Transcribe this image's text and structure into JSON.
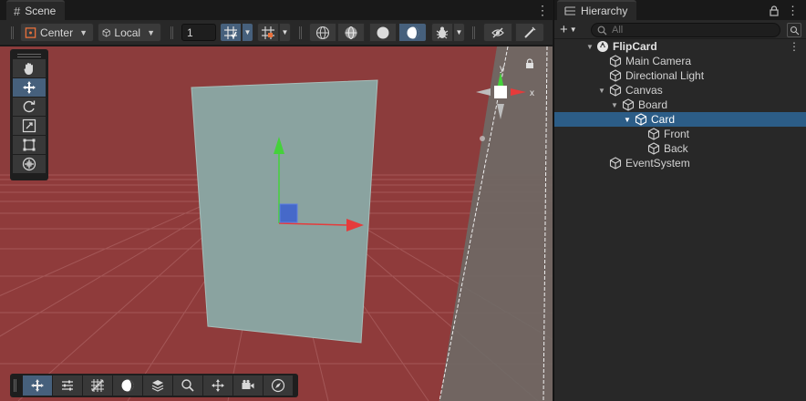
{
  "scene_tab": {
    "title": "Scene",
    "menu_glyph": "⋮"
  },
  "scene_toolbar": {
    "pivot_label": "Center",
    "space_label": "Local",
    "grid_size_value": "1"
  },
  "hierarchy_tab": {
    "title": "Hierarchy",
    "menu_glyph": "⋮"
  },
  "hierarchy_toolbar": {
    "add_label": "+",
    "search_placeholder": "All"
  },
  "hierarchy": {
    "items": [
      {
        "label": "FlipCard",
        "type": "scene",
        "expanded": true,
        "selected": false
      },
      {
        "label": "Main Camera",
        "type": "gameobject",
        "selected": false
      },
      {
        "label": "Directional Light",
        "type": "gameobject",
        "selected": false
      },
      {
        "label": "Canvas",
        "type": "gameobject",
        "expanded": true,
        "selected": false
      },
      {
        "label": "Board",
        "type": "gameobject",
        "expanded": true,
        "selected": false
      },
      {
        "label": "Card",
        "type": "gameobject",
        "expanded": true,
        "selected": true
      },
      {
        "label": "Front",
        "type": "gameobject",
        "selected": false
      },
      {
        "label": "Back",
        "type": "gameobject",
        "selected": false
      },
      {
        "label": "EventSystem",
        "type": "gameobject",
        "selected": false
      }
    ]
  },
  "gizmo": {
    "axis_y_label": "y",
    "axis_x_label": "x"
  },
  "colors": {
    "sky": "#8a3a3a",
    "ground": "#8f3b3b",
    "card_face": "#8aa3a0",
    "selection": "#2c5d87",
    "active_tool": "#46607c",
    "axis_x": "#e53b3b",
    "axis_y": "#45d13b",
    "axis_z": "#3b5fd1"
  },
  "icons": {
    "tools": [
      "hand-icon",
      "move-icon",
      "rotate-icon",
      "scale-icon",
      "rect-icon",
      "transform-icon"
    ],
    "overlays": [
      "view-options-icon",
      "sliders-icon",
      "grid-toggle-icon",
      "shading-icon",
      "layers-icon",
      "search-icon",
      "orientation-icon",
      "camera-icon",
      "compass-icon"
    ]
  }
}
